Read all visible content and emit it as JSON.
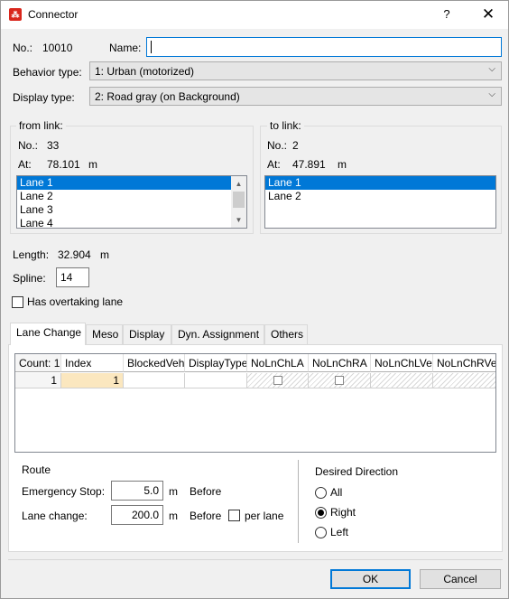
{
  "window": {
    "title": "Connector",
    "help": "?",
    "close": "✕",
    "icon": "app-logo-icon"
  },
  "header": {
    "no_label": "No.:",
    "no_value": "10010",
    "name_label": "Name:",
    "name_value": "",
    "behavior_label": "Behavior type:",
    "behavior_value": "1: Urban (motorized)",
    "display_label": "Display type:",
    "display_value": "2: Road gray (on Background)"
  },
  "from_link": {
    "title": "from link:",
    "no_label": "No.:",
    "no_value": "33",
    "at_label": "At:",
    "at_value": "78.101",
    "at_unit": "m",
    "lanes": [
      "Lane 1",
      "Lane 2",
      "Lane 3",
      "Lane 4"
    ],
    "selected": 0
  },
  "to_link": {
    "title": "to link:",
    "no_label": "No.:",
    "no_value": "2",
    "at_label": "At:",
    "at_value": "47.891",
    "at_unit": "m",
    "lanes": [
      "Lane 1",
      "Lane 2"
    ],
    "selected": 0
  },
  "geometry": {
    "length_label": "Length:",
    "length_value": "32.904",
    "length_unit": "m",
    "spline_label": "Spline:",
    "spline_value": "14",
    "overtaking_label": "Has overtaking lane",
    "overtaking_checked": false
  },
  "tabs": [
    "Lane Change",
    "Meso",
    "Display",
    "Dyn. Assignment",
    "Others"
  ],
  "active_tab": 0,
  "grid": {
    "columns": [
      "Count: 1",
      "Index",
      "BlockedVeh",
      "DisplayType",
      "NoLnChLA",
      "NoLnChRA",
      "NoLnChLVe",
      "NoLnChRVe"
    ],
    "row": {
      "count": "1",
      "index": "1"
    }
  },
  "route": {
    "title": "Route",
    "emergency_label": "Emergency Stop:",
    "emergency_value": "5.0",
    "emergency_unit": "m",
    "emergency_suffix": "Before",
    "lanechange_label": "Lane change:",
    "lanechange_value": "200.0",
    "lanechange_unit": "m",
    "lanechange_suffix": "Before",
    "per_lane_label": "per lane",
    "per_lane_checked": false
  },
  "direction": {
    "title": "Desired Direction",
    "options": [
      "All",
      "Right",
      "Left"
    ],
    "selected": 1
  },
  "buttons": {
    "ok": "OK",
    "cancel": "Cancel"
  }
}
